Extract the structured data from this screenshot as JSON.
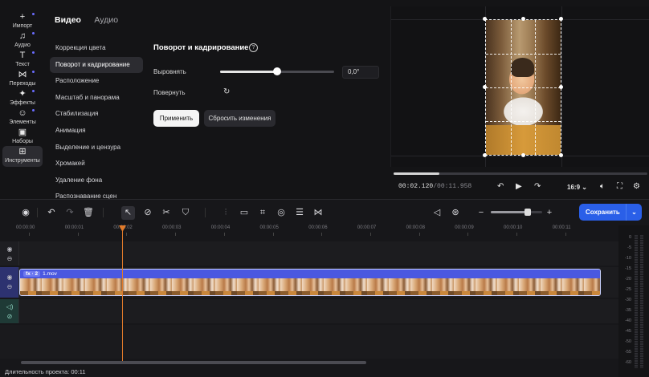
{
  "rail": {
    "items": [
      {
        "label": "Импорт",
        "icon": "plus-icon",
        "glyph": "+"
      },
      {
        "label": "Аудио",
        "icon": "music-note-icon",
        "glyph": "♫"
      },
      {
        "label": "Текст",
        "icon": "text-icon",
        "glyph": "T"
      },
      {
        "label": "Переходы",
        "icon": "transition-icon",
        "glyph": "⋈"
      },
      {
        "label": "Эффекты",
        "icon": "sparkle-icon",
        "glyph": "✦"
      },
      {
        "label": "Элементы",
        "icon": "smiley-icon",
        "glyph": "☺"
      },
      {
        "label": "Наборы",
        "icon": "bag-icon",
        "glyph": "▣"
      },
      {
        "label": "Инструменты",
        "icon": "tools-grid-icon",
        "glyph": "⊞"
      }
    ],
    "active_index": 7
  },
  "panel": {
    "tabs": {
      "video": "Видео",
      "audio": "Аудио"
    },
    "menu": [
      "Коррекция цвета",
      "Поворот и кадрирование",
      "Расположение",
      "Масштаб и панорама",
      "Стабилизация",
      "Анимация",
      "Выделение и цензура",
      "Хромакей",
      "Удаление фона",
      "Распознавание сцен"
    ],
    "menu_active_index": 1,
    "section_title": "Поворот и кадрирование",
    "straighten_label": "Выровнять",
    "straighten_slider_fraction": 0.5,
    "angle_value": "0,0°",
    "rotate_label": "Повернуть",
    "apply_label": "Применить",
    "reset_label": "Сбросить изменения"
  },
  "preview": {
    "timecode_current": "00:02.120",
    "timecode_total": "/00:11.958",
    "progress_fraction": 0.18,
    "aspect_ratio": "16:9"
  },
  "timeline": {
    "save_label": "Сохранить",
    "zoom_fraction": 0.72,
    "ruler_labels": [
      "00:00:00",
      "00:00:01",
      "00:00:02",
      "00:00:03",
      "00:00:04",
      "00:00:05",
      "00:00:06",
      "00:00:07",
      "00:00:08",
      "00:00:09",
      "00:00:10",
      "00:00:11"
    ],
    "clip": {
      "fx_label": "fx · 2",
      "name": "1.mov"
    },
    "meter_labels": [
      "0",
      "-5",
      "-10",
      "-15",
      "-20",
      "-25",
      "-30",
      "-35",
      "-40",
      "-45",
      "-50",
      "-55",
      "-60"
    ],
    "project_duration": "Длительность проекта: 00:11"
  },
  "colors": {
    "accent": "#2a5fe8",
    "playhead": "#e07a2a",
    "clip": "#4a58e0"
  }
}
